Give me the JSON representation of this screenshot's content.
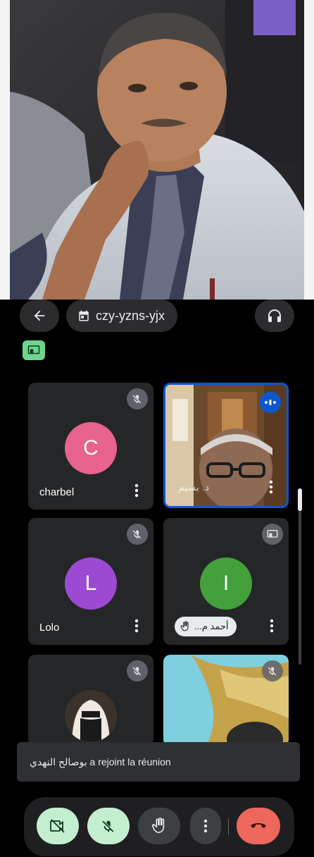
{
  "meeting": {
    "code": "czy-yzns-yjx"
  },
  "participants": [
    {
      "name": "charbel",
      "initial": "C",
      "color": "#e8638d"
    },
    {
      "name": "Lolo",
      "initial": "L",
      "color": "#9c4ad3"
    },
    {
      "name": "أحمد م...",
      "initial": "I",
      "color": "#43a03b"
    }
  ],
  "active_video": {
    "name": "د. بسيم"
  },
  "toast": {
    "message": "بوصالح النهدي a rejoint la réunion"
  },
  "colors": {
    "accent_blue": "#0b57d0",
    "end_call": "#ee675c",
    "control_active": "#c4eed0",
    "cast_green": "#6dd58c"
  },
  "icons": [
    "back-arrow-icon",
    "calendar-icon",
    "headphones-icon",
    "cast-icon",
    "mic-off-icon",
    "more-vert-icon",
    "speaking-icon",
    "hand-icon",
    "video-off-icon",
    "call-end-icon"
  ]
}
